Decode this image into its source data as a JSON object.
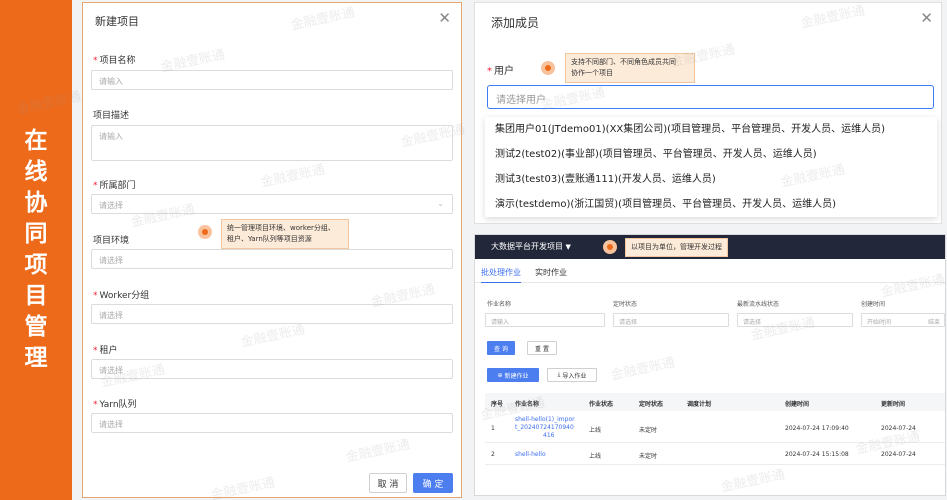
{
  "banner": {
    "chars": [
      "在",
      "线",
      "协",
      "同",
      "项",
      "目",
      "管",
      "理"
    ]
  },
  "new_project": {
    "title": "新建项目",
    "fields": {
      "name": {
        "label": "项目名称",
        "placeholder": "请输入"
      },
      "desc": {
        "label": "项目描述",
        "placeholder": "请输入"
      },
      "dept": {
        "label": "所属部门",
        "placeholder": "请选择"
      },
      "env": {
        "label": "项目环境",
        "placeholder": "请选择"
      },
      "worker": {
        "label": "Worker分组",
        "placeholder": "请选择"
      },
      "tenant": {
        "label": "租户",
        "placeholder": "请选择"
      },
      "yarn": {
        "label": "Yarn队列",
        "placeholder": "请选择"
      }
    },
    "required_mark": "*",
    "tip": [
      "统一管理项目环境、worker分组、",
      "租户、Yarn队列等项目资源"
    ],
    "cancel_label": "取 消",
    "ok_label": "确 定"
  },
  "add_member": {
    "title": "添加成员",
    "user_label": "用户",
    "required_mark": "*",
    "placeholder": "请选择用户",
    "tip": [
      "支持不同部门、不同角色成员共同",
      "协作一个项目"
    ],
    "options": [
      "集团用户01(JTdemo01)(XX集团公司)(项目管理员、平台管理员、开发人员、运维人员)",
      "测试2(test02)(事业部)(项目管理员、平台管理员、开发人员、运维人员)",
      "测试3(test03)(壹账通111)(开发人员、运维人员)",
      "演示(testdemo)(浙江国贸)(项目管理员、平台管理员、开发人员、运维人员)"
    ]
  },
  "job_panel": {
    "title": "大数据平台开发项目",
    "caret": "▼",
    "tip": "以项目为单位，管理开发过程",
    "tabs": [
      "批处理作业",
      "实时作业"
    ],
    "filters": [
      {
        "label": "作业名称",
        "placeholder": "请输入"
      },
      {
        "label": "定时状态",
        "placeholder": "请选择"
      },
      {
        "label": "最新流水线状态",
        "placeholder": "请选择"
      },
      {
        "label": "创建时间",
        "placeholder": "开始时间",
        "end": "结束"
      }
    ],
    "query_label": "查 询",
    "reset_label": "重 置",
    "new_label": "新建作业",
    "import_label": "导入作业",
    "columns": [
      "序号",
      "作业名称",
      "作业状态",
      "定时状态",
      "调度计划",
      "创建时间",
      "更新时间"
    ],
    "rows": [
      {
        "no": "1",
        "name": [
          "shell-hello(1)_impor",
          "t_20240724170940",
          "416"
        ],
        "status": "上线",
        "timer": "未定时",
        "schedule": "",
        "created": "2024-07-24 17:09:40",
        "updated": "2024-07-24"
      },
      {
        "no": "2",
        "name": [
          "shell-hello"
        ],
        "status": "上线",
        "timer": "未定时",
        "schedule": "",
        "created": "2024-07-24 15:15:08",
        "updated": "2024-07-24"
      }
    ]
  },
  "watermark": "金融壹账通",
  "colors": {
    "brand_orange": "#ee6a1b",
    "primary_blue": "#4d7ef0",
    "dark_bar": "#23273a"
  }
}
